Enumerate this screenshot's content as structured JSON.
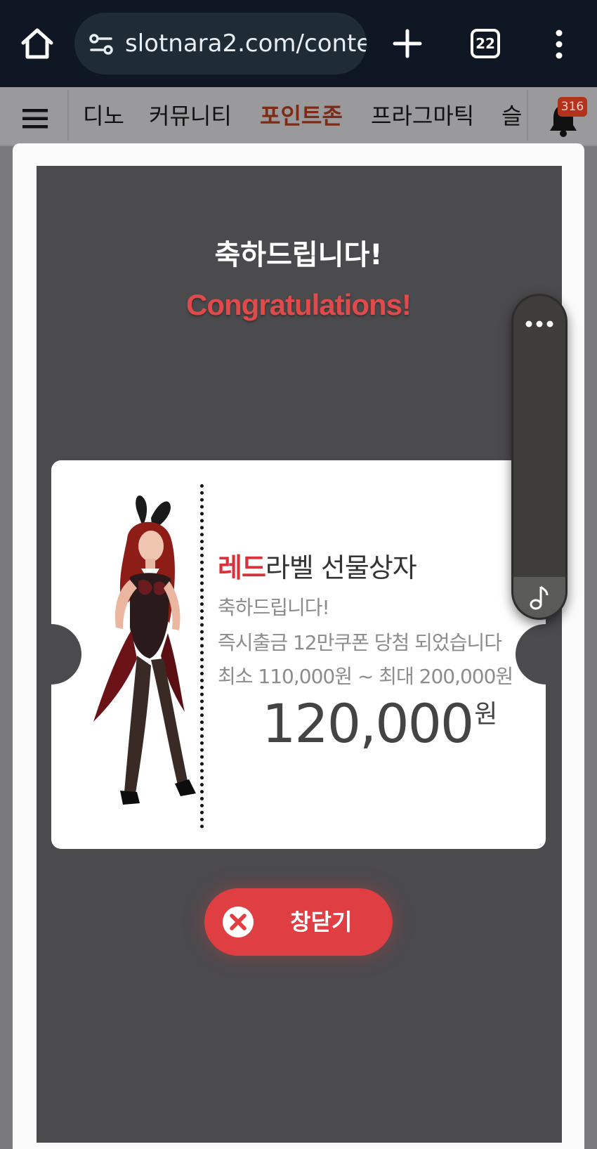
{
  "browser": {
    "url": "slotnara2.com/conte",
    "tab_count": "22"
  },
  "site_nav": {
    "items": [
      {
        "label": "디노",
        "active": false
      },
      {
        "label": "커뮤니티",
        "active": false
      },
      {
        "label": "포인트존",
        "active": true
      },
      {
        "label": "프라그마틱",
        "active": false
      },
      {
        "label": "슬",
        "active": false
      }
    ],
    "notification_count": "316"
  },
  "popup": {
    "title_ko": "축하드립니다!",
    "title_en": "Congratulations!",
    "prize_title_highlight": "레드",
    "prize_title_rest": "라벨 선물상자",
    "message_1": "축하드립니다!",
    "message_2": "즉시출금 12만쿠폰 당첨 되었습니다",
    "message_3": "최소 110,000원 ~ 최대 200,000원",
    "amount": "120,000",
    "amount_unit": "원",
    "close_label": "창닫기"
  },
  "colors": {
    "accent_red": "#df3e42",
    "popup_bg": "#4b4a4d",
    "browser_bar": "#0f1724",
    "active_nav": "#7d2b16"
  },
  "icons": [
    "home-icon",
    "site-settings-icon",
    "plus-icon",
    "tabs-icon",
    "more-vert-icon",
    "hamburger-icon",
    "bell-icon",
    "close-icon",
    "more-horiz-icon",
    "music-note-icon"
  ]
}
